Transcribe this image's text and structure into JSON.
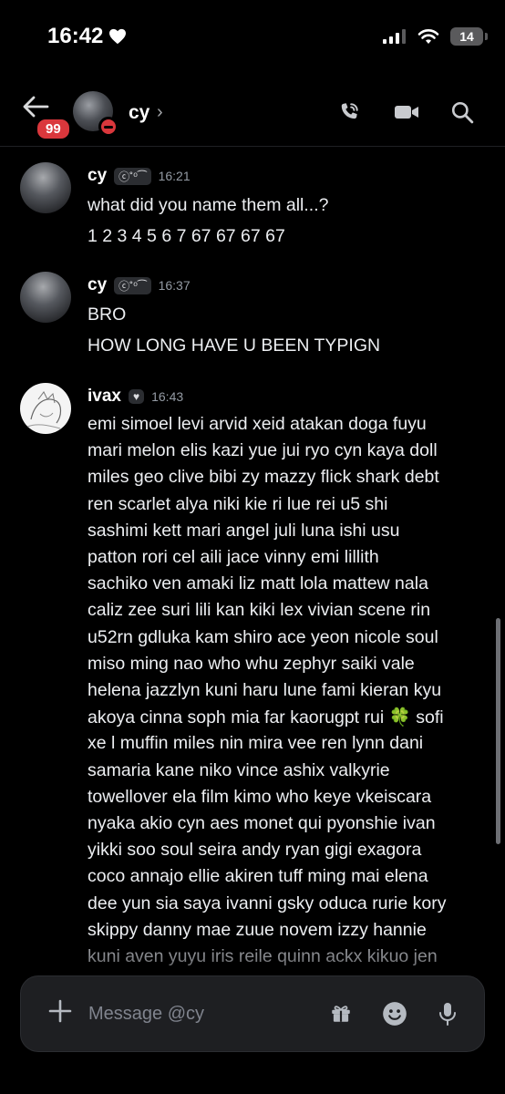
{
  "status": {
    "time": "16:42",
    "battery": "14"
  },
  "header": {
    "name": "cy",
    "unread_badge": "99"
  },
  "messages": [
    {
      "author": "cy",
      "tag": "ⓒ˚⁰⁀",
      "time": "16:21",
      "lines": [
        "what did you name them all...?",
        "1 2 3 4 5 6 7 67 67 67 67"
      ]
    },
    {
      "author": "cy",
      "tag": "ⓒ˚⁰⁀",
      "time": "16:37",
      "lines": [
        "BRO",
        "HOW LONG HAVE U BEEN TYPIGN"
      ]
    },
    {
      "author": "ivax",
      "tag": "♥",
      "time": "16:43",
      "lines": [
        "emi simoel levi arvid xeid atakan doga fuyu",
        "mari melon elis kazi yue jui ryo cyn kaya doll",
        "miles geo clive bibi zy mazzy flick shark debt",
        "ren scarlet alya niki kie ri lue rei u5 shi",
        "sashimi kett mari angel juli luna ishi usu",
        "patton rori cel aili jace vinny emi lillith",
        "sachiko ven amaki liz matt lola mattew nala",
        "caliz zee suri lili kan kiki lex vivian scene rin",
        "u52rn gdluka kam shiro ace yeon nicole soul",
        "miso ming nao who whu zephyr saiki vale",
        "helena jazzlyn kuni haru lune fami kieran kyu",
        "akoya cinna soph mia far kaorugpt rui 🍀 sofi",
        "xe l muffin miles nin mira vee ren lynn dani",
        "samaria kane niko vince ashix valkyrie",
        "towellover ela film kimo who keye vkeiscara",
        "nyaka akio cyn aes monet qui pyonshie ivan",
        "yikki soo soul seira andy ryan gigi exagora",
        "coco annajo ellie akiren tuff ming mai elena",
        "dee yun sia saya ivanni gsky oduca rurie kory",
        "skippy danny mae zuue novem izzy hannie",
        "kuni aven  yuyu iris reile quinn ackx kikuo jen"
      ]
    }
  ],
  "composer": {
    "placeholder": "Message @cy"
  }
}
